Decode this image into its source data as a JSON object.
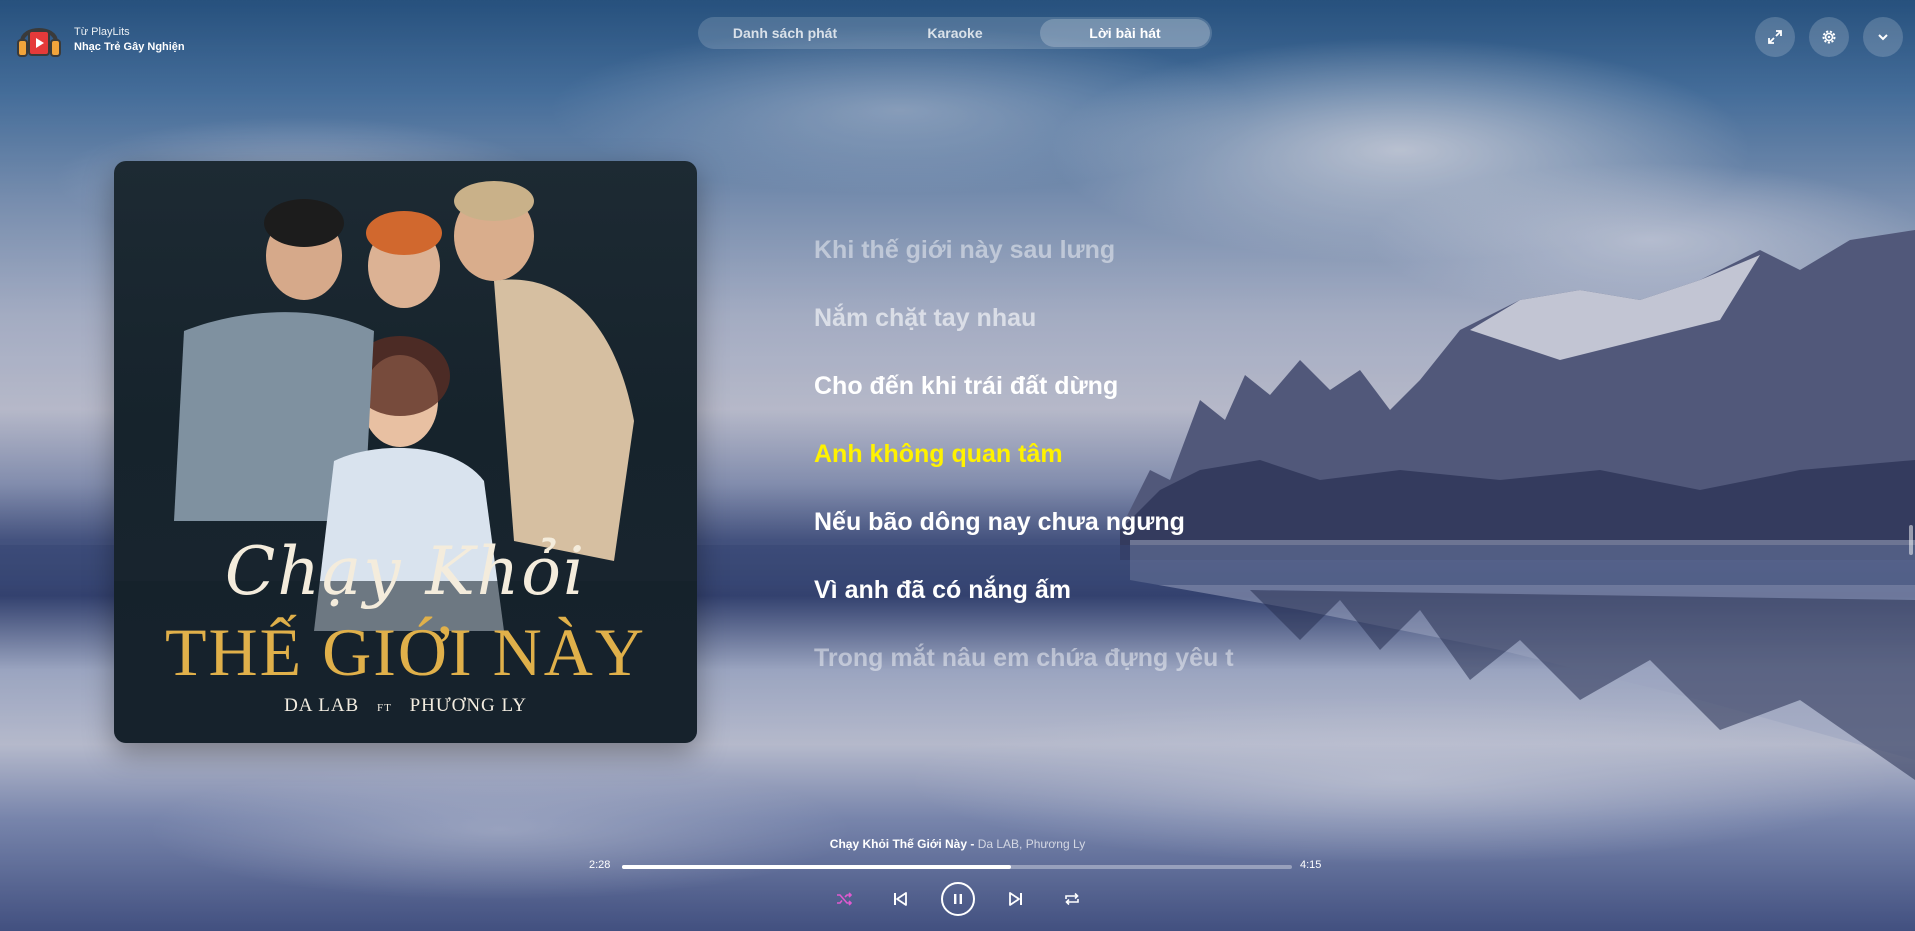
{
  "header": {
    "playlist_label": "Từ PlayLits",
    "playlist_name": "Nhạc Trẻ Gây Nghiện"
  },
  "tabs": [
    {
      "label": "Danh sách phát",
      "active": false
    },
    {
      "label": "Karaoke",
      "active": false
    },
    {
      "label": "Lời bài hát",
      "active": true
    }
  ],
  "actions": [
    "expand-icon",
    "settings-icon",
    "chevron-down-icon"
  ],
  "album": {
    "script_title": "Chạy Khỏi",
    "main_title": "THẾ GIỚI NÀY",
    "artist_left": "DA LAB",
    "ft": "FT",
    "artist_right": "PHƯƠNG LY"
  },
  "lyrics": [
    {
      "text": "Khi thế giới này sau lưng",
      "state": "dim1"
    },
    {
      "text": "Nắm chặt tay nhau",
      "state": "dim2"
    },
    {
      "text": "Cho đến khi trái đất dừng",
      "state": "normal"
    },
    {
      "text": "Anh không quan tâm",
      "state": "active"
    },
    {
      "text": "Nếu bão dông nay chưa ngưng",
      "state": "normal"
    },
    {
      "text": "Vì anh đã có nắng ấm",
      "state": "normal"
    },
    {
      "text": "Trong mắt nâu em chứa đựng yêu thương",
      "state": "fade"
    }
  ],
  "player": {
    "song_title": "Chạy Khỏi Thế Giới Này - ",
    "song_artists": "Da LAB, Phương Ly",
    "current_time": "2:28",
    "total_time": "4:15",
    "progress": 0.58,
    "shuffle_color": "#e05ad0"
  }
}
